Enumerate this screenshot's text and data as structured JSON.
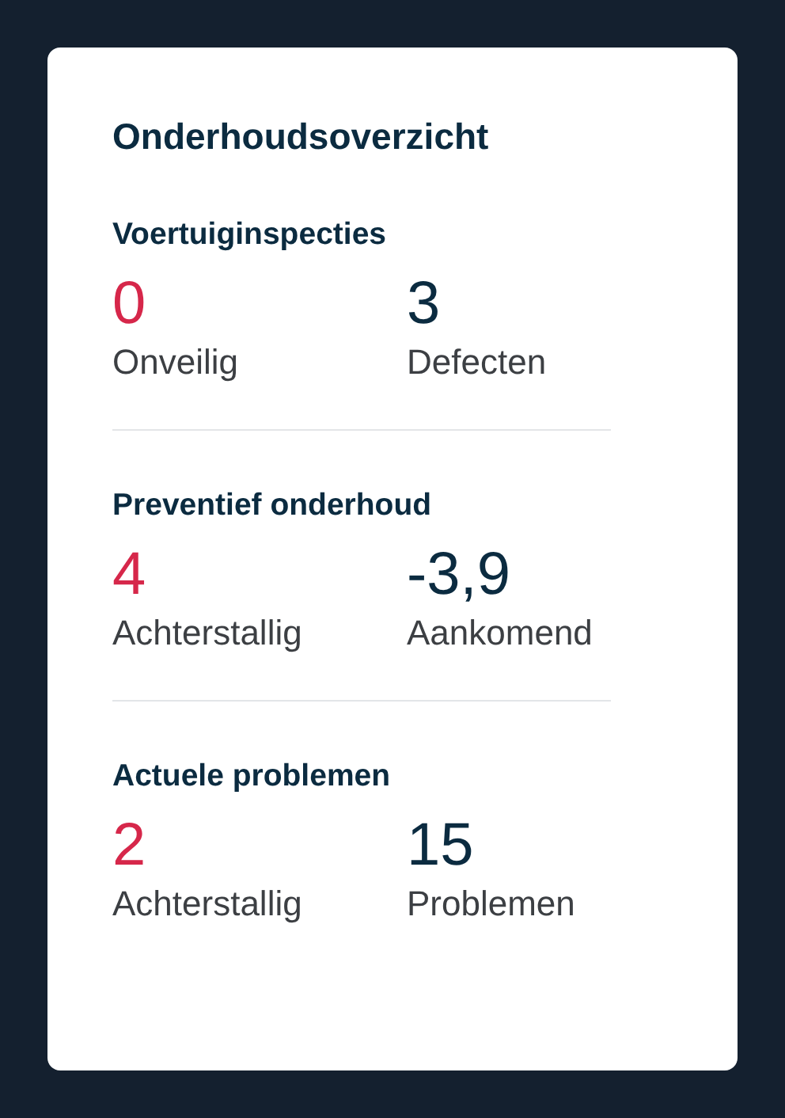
{
  "card": {
    "title": "Onderhoudsoverzicht",
    "sections": [
      {
        "heading": "Voertuiginspecties",
        "stats": [
          {
            "value": "0",
            "label": "Onveilig",
            "alert": true
          },
          {
            "value": "3",
            "label": "Defecten",
            "alert": false
          }
        ]
      },
      {
        "heading": "Preventief onderhoud",
        "stats": [
          {
            "value": "4",
            "label": "Achterstallig",
            "alert": true
          },
          {
            "value": "-3,9",
            "label": "Aankomend",
            "alert": false
          }
        ]
      },
      {
        "heading": "Actuele problemen",
        "stats": [
          {
            "value": "2",
            "label": "Achterstallig",
            "alert": true
          },
          {
            "value": "15",
            "label": "Problemen",
            "alert": false
          }
        ]
      }
    ]
  }
}
